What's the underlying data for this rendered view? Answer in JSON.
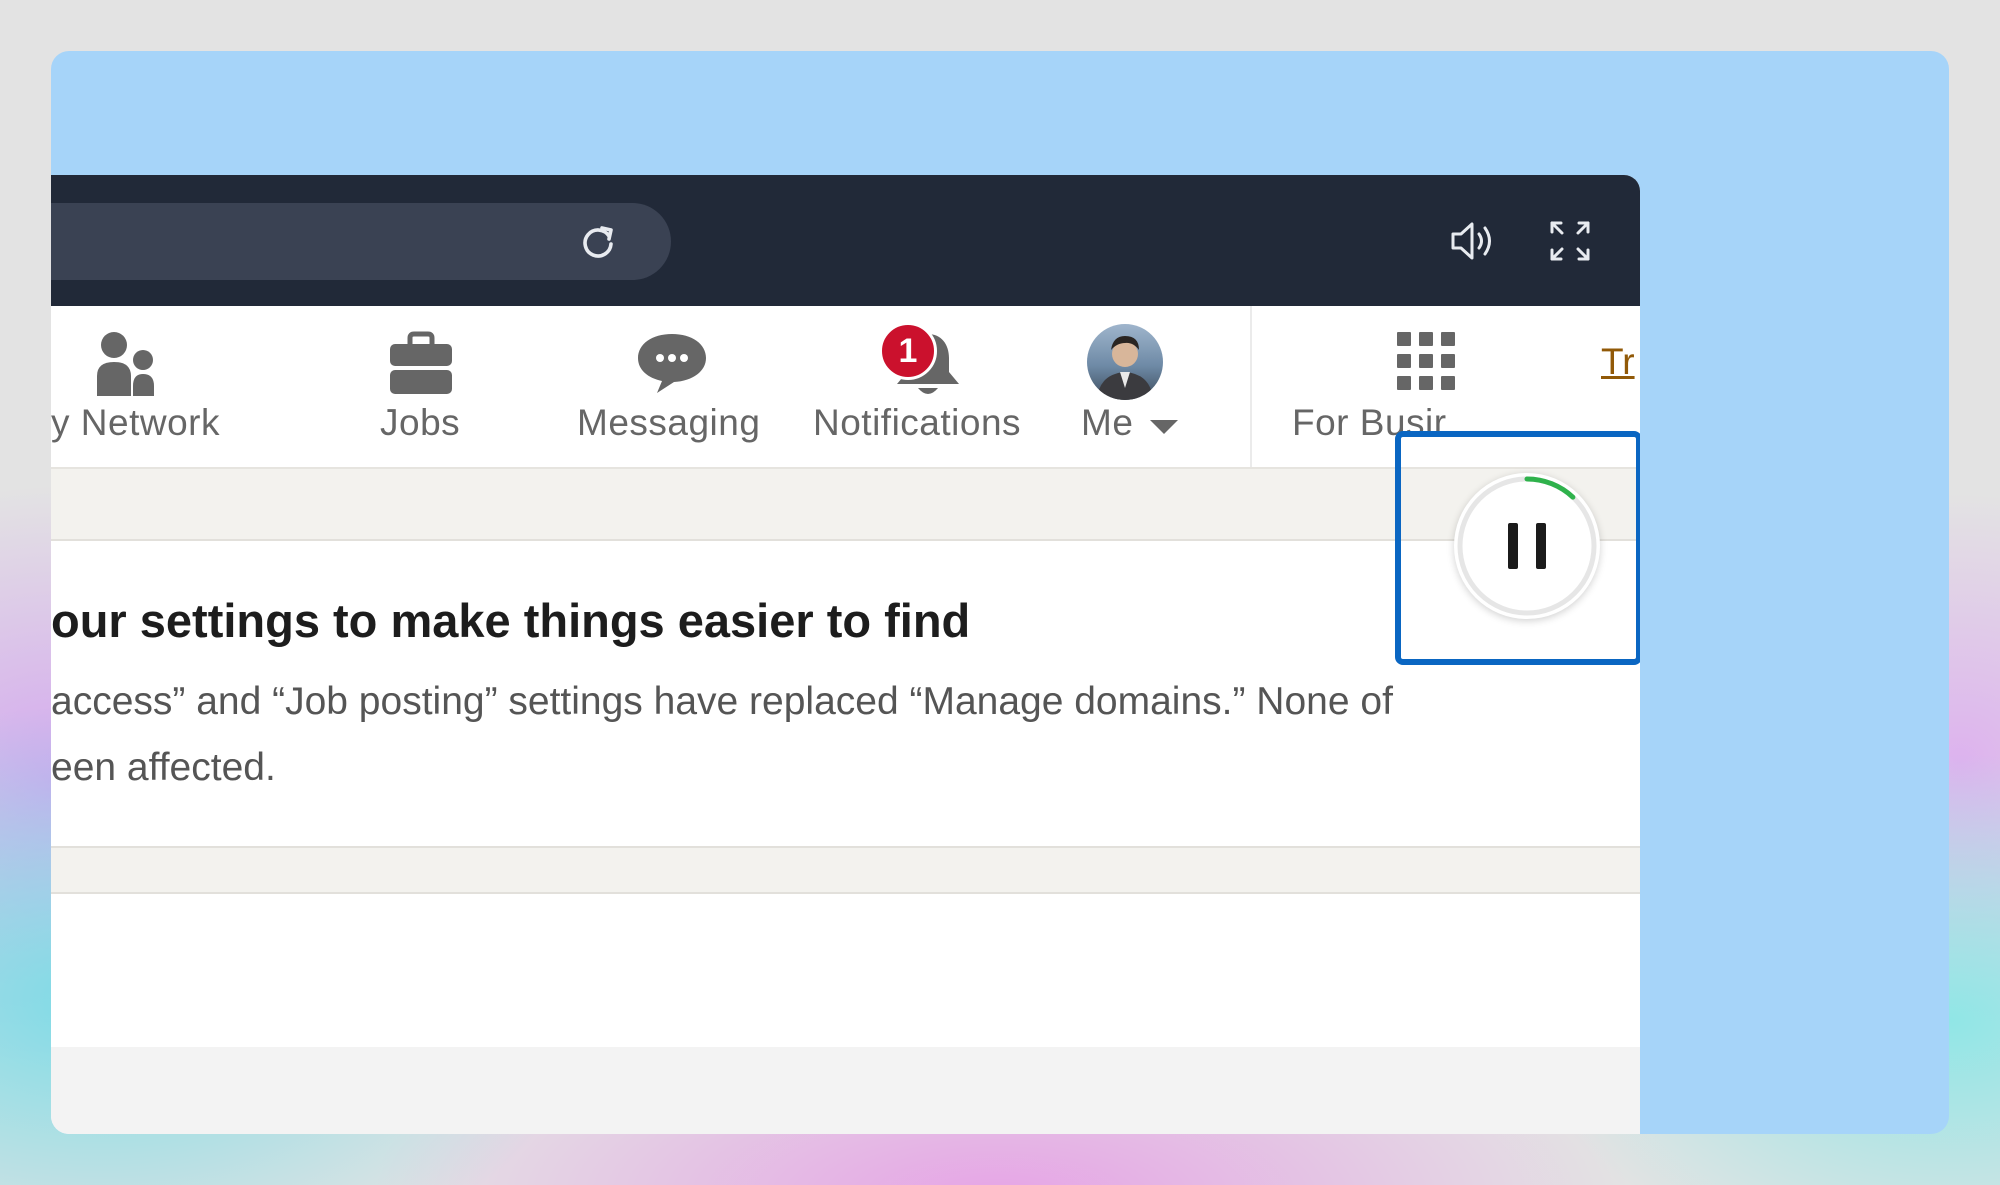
{
  "nav": {
    "network_label": "y Network",
    "jobs_label": "Jobs",
    "messaging_label": "Messaging",
    "notifications_label": "Notifications",
    "notifications_count": "1",
    "me_label": "Me",
    "for_business_label": "For Busir",
    "try_label": "Tr"
  },
  "content": {
    "title": "our settings to make things easier to find",
    "body_line1": "access” and “Job posting” settings have replaced “Manage domains.” None of",
    "body_line2": "een affected."
  },
  "colors": {
    "stage_background": "#a6d4f9",
    "chrome_bar": "#212938",
    "badge": "#cb112d",
    "highlight": "#0a66c2",
    "progress_ring": "#2fb24c"
  },
  "icons": {
    "reload": "reload-icon",
    "speaker": "speaker-icon",
    "fullscreen": "fullscreen-icon",
    "network": "people-icon",
    "jobs": "briefcase-icon",
    "messaging": "chat-bubble-icon",
    "notifications": "bell-icon",
    "me": "avatar",
    "grid": "grid-icon",
    "pause": "pause-icon"
  },
  "playback": {
    "progress_fraction": 0.12
  }
}
